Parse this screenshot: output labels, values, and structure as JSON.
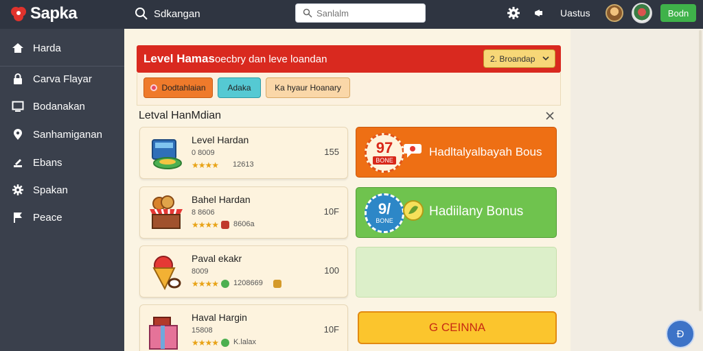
{
  "app": {
    "name": "Sapka"
  },
  "topbar": {
    "search_label": "Sdkangan",
    "search_placeholder": "Sanlalm",
    "username": "Uastus",
    "action_button": "Bodn"
  },
  "sidebar": {
    "items": [
      {
        "label": "Harda",
        "icon": "home-icon"
      },
      {
        "label": "Carva Flayar",
        "icon": "lock-icon"
      },
      {
        "label": "Bodanakan",
        "icon": "monitor-icon"
      },
      {
        "label": "Sanhamiganan",
        "icon": "location-pin-icon"
      },
      {
        "label": "Ebans",
        "icon": "upload-icon"
      },
      {
        "label": "Spakan",
        "icon": "gear-icon"
      },
      {
        "label": "Peace",
        "icon": "flag-icon"
      }
    ]
  },
  "banner": {
    "title": "Level Hamas",
    "subtitle": "oecbry dan leve loandan",
    "dropdown_value": "2. Broandap"
  },
  "filters": [
    {
      "label": "Dodtahlaian"
    },
    {
      "label": "Adaka"
    },
    {
      "label": "Ka hyaur Hoanary"
    }
  ],
  "section": {
    "title": "Letval HanMdian"
  },
  "cards": [
    {
      "name": "Level Hardan",
      "sub": "0 8009",
      "stars": "★★★★",
      "meta": "12613",
      "count": "155",
      "icon": "treasure-box-icon"
    },
    {
      "name": "Bahel Hardan",
      "sub": "8 8606",
      "stars": "★★★★",
      "meta": "8606a",
      "count": "10F",
      "icon": "market-stall-icon"
    },
    {
      "name": "Paval ekakr",
      "sub": "8009",
      "stars": "★★★★",
      "meta": "1208669",
      "count": "100",
      "icon": "food-cone-icon"
    },
    {
      "name": "Haval Hargin",
      "sub": "15808",
      "stars": "★★★★",
      "meta": "K.lalax",
      "count": "10F",
      "icon": "gift-box-icon"
    }
  ],
  "tiles": [
    {
      "seal_number": "97",
      "seal_text": "BONE",
      "label": "Hadltalyalbayah Bous",
      "color": "#ee6f14"
    },
    {
      "seal_number": "9/",
      "seal_text": "BONE",
      "label": "Hadiilany Bonus",
      "color": "#6fc34e"
    }
  ],
  "cta": {
    "label": "G CEINNA"
  },
  "fab": {
    "label": "Ð"
  },
  "colors": {
    "topbar": "#2f3541",
    "sidebar": "#3a404c",
    "banner_red": "#d9291f",
    "accent_green": "#3fb24a"
  }
}
